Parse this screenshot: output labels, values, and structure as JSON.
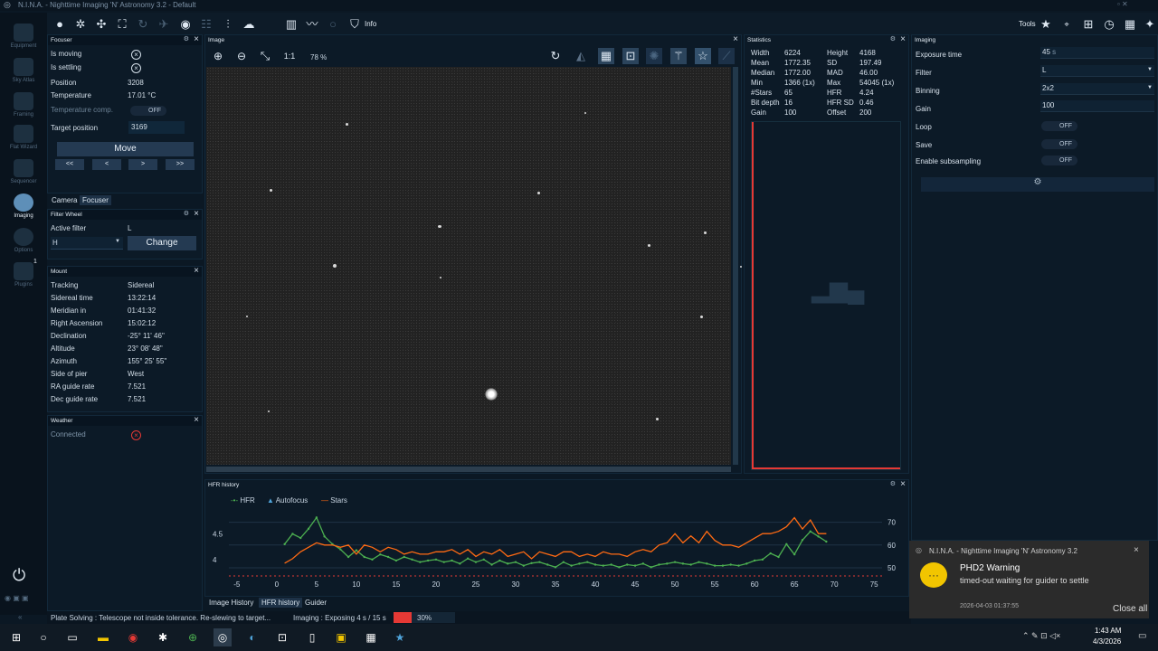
{
  "titlebar": {
    "title": "N.I.N.A. - Nighttime Imaging 'N' Astronomy 3.2  -  Default"
  },
  "toolbar": {
    "info_label": "Info",
    "tools_label": "Tools"
  },
  "sidebar": {
    "items": [
      {
        "label": "Equipment"
      },
      {
        "label": "Sky Atlas"
      },
      {
        "label": "Framing"
      },
      {
        "label": "Flat Wizard"
      },
      {
        "label": "Sequencer"
      },
      {
        "label": "Imaging"
      },
      {
        "label": "Options"
      },
      {
        "label": "Plugins"
      }
    ],
    "plugins_badge": "1"
  },
  "focuser": {
    "title": "Focuser",
    "rows": [
      {
        "label": "Is moving",
        "value": ""
      },
      {
        "label": "Is settling",
        "value": ""
      },
      {
        "label": "Position",
        "value": "3208"
      },
      {
        "label": "Temperature",
        "value": "17.01 °C"
      }
    ],
    "temp_comp_label": "Temperature comp.",
    "temp_comp_value": "OFF",
    "target_label": "Target position",
    "target_value": "3169",
    "move_label": "Move",
    "step_buttons": [
      "<<",
      "<",
      ">",
      ">>"
    ]
  },
  "tabs_left": {
    "camera": "Camera",
    "focuser": "Focuser"
  },
  "filter_wheel": {
    "title": "Filter Wheel",
    "active_label": "Active filter",
    "active_value": "L",
    "select_value": "H",
    "change_label": "Change"
  },
  "mount": {
    "title": "Mount",
    "rows": [
      {
        "label": "Tracking",
        "value": "Sidereal"
      },
      {
        "label": "Sidereal time",
        "value": "13:22:14"
      },
      {
        "label": "Meridian in",
        "value": "01:41:32"
      },
      {
        "label": "Right Ascension",
        "value": "15:02:12"
      },
      {
        "label": "Declination",
        "value": "-25° 11' 46\""
      },
      {
        "label": "Altitude",
        "value": "23° 08' 48\""
      },
      {
        "label": "Azimuth",
        "value": "155° 25' 55\""
      },
      {
        "label": "Side of pier",
        "value": "West"
      },
      {
        "label": "RA guide rate",
        "value": "7.521"
      },
      {
        "label": "Dec guide rate",
        "value": "7.521"
      }
    ]
  },
  "weather": {
    "title": "Weather",
    "connected_label": "Connected"
  },
  "image": {
    "title": "Image",
    "one_to_one": "1:1",
    "zoom": "78 %"
  },
  "statistics": {
    "title": "Statistics",
    "left": [
      {
        "label": "Width",
        "value": "6224"
      },
      {
        "label": "Mean",
        "value": "1772.35"
      },
      {
        "label": "Median",
        "value": "1772.00"
      },
      {
        "label": "Min",
        "value": "1366 (1x)"
      },
      {
        "label": "#Stars",
        "value": "65"
      },
      {
        "label": "Bit depth",
        "value": "16"
      },
      {
        "label": "Gain",
        "value": "100"
      }
    ],
    "right": [
      {
        "label": "Height",
        "value": "4168"
      },
      {
        "label": "SD",
        "value": "197.49"
      },
      {
        "label": "MAD",
        "value": "46.00"
      },
      {
        "label": "Max",
        "value": "54045 (1x)"
      },
      {
        "label": "HFR",
        "value": "4.24"
      },
      {
        "label": "HFR SD",
        "value": "0.46"
      },
      {
        "label": "Offset",
        "value": "200"
      }
    ]
  },
  "imaging": {
    "title": "Imaging",
    "fields": [
      {
        "label": "Exposure time",
        "value": "45",
        "unit": "s"
      },
      {
        "label": "Filter",
        "value": "L"
      },
      {
        "label": "Binning",
        "value": "2x2"
      },
      {
        "label": "Gain",
        "value": "100"
      }
    ],
    "toggles": [
      {
        "label": "Loop",
        "value": "OFF"
      },
      {
        "label": "Save",
        "value": "OFF"
      },
      {
        "label": "Enable subsampling",
        "value": "OFF"
      }
    ]
  },
  "hfr_history": {
    "title": "HFR history",
    "legend": [
      "HFR",
      "Autofocus",
      "Stars"
    ]
  },
  "chart_data": {
    "type": "line",
    "title": "",
    "x_ticks": [
      "-5",
      "0",
      "5",
      "10",
      "15",
      "20",
      "25",
      "30",
      "35",
      "40",
      "45",
      "50",
      "55",
      "60",
      "65",
      "70",
      "75"
    ],
    "y_left_ticks": [
      "4.5",
      "4"
    ],
    "y_right_ticks": [
      "70",
      "60",
      "50"
    ],
    "xlim": [
      -6,
      76
    ],
    "ylim_left": [
      3.75,
      4.95
    ],
    "ylim_right": [
      48,
      75
    ],
    "colors": {
      "hfr": "#4caf50",
      "stars": "#ff6a13"
    },
    "series": [
      {
        "name": "HFR",
        "axis": "left",
        "x": [
          1,
          2,
          3,
          4,
          5,
          6,
          7,
          8,
          9,
          10,
          11,
          12,
          13,
          14,
          15,
          16,
          17,
          18,
          19,
          20,
          21,
          22,
          23,
          24,
          25,
          26,
          27,
          28,
          29,
          30,
          31,
          32,
          33,
          34,
          35,
          36,
          37,
          38,
          39,
          40,
          41,
          42,
          43,
          44,
          45,
          46,
          47,
          48,
          49,
          50,
          51,
          52,
          53,
          54,
          55,
          56,
          57,
          58,
          59,
          60,
          61,
          62,
          63,
          64,
          65,
          66,
          67,
          68,
          69
        ],
        "values": [
          4.3,
          4.5,
          4.42,
          4.6,
          4.82,
          4.45,
          4.3,
          4.2,
          4.05,
          4.18,
          4.05,
          4.0,
          4.1,
          4.05,
          3.98,
          4.05,
          4.0,
          3.95,
          3.98,
          4.0,
          3.95,
          3.98,
          3.92,
          4.02,
          3.95,
          4.0,
          3.9,
          3.98,
          3.92,
          3.95,
          3.88,
          3.93,
          3.95,
          3.9,
          3.85,
          3.95,
          3.88,
          3.92,
          3.95,
          3.9,
          3.88,
          3.9,
          3.85,
          3.9,
          3.88,
          3.92,
          3.85,
          3.9,
          3.92,
          3.95,
          3.92,
          3.9,
          3.95,
          3.92,
          3.88,
          3.88,
          3.9,
          3.88,
          3.92,
          3.98,
          4.0,
          4.12,
          4.05,
          4.3,
          4.1,
          4.38,
          4.55,
          4.45,
          4.35
        ]
      },
      {
        "name": "Stars",
        "axis": "right",
        "x": [
          1,
          2,
          3,
          4,
          5,
          6,
          7,
          8,
          9,
          10,
          11,
          12,
          13,
          14,
          15,
          16,
          17,
          18,
          19,
          20,
          21,
          22,
          23,
          24,
          25,
          26,
          27,
          28,
          29,
          30,
          31,
          32,
          33,
          34,
          35,
          36,
          37,
          38,
          39,
          40,
          41,
          42,
          43,
          44,
          45,
          46,
          47,
          48,
          49,
          50,
          51,
          52,
          53,
          54,
          55,
          56,
          57,
          58,
          59,
          60,
          61,
          62,
          63,
          64,
          65,
          66,
          67,
          68,
          69
        ],
        "values": [
          52,
          54,
          57,
          59,
          61,
          60,
          60,
          59,
          60,
          56,
          60,
          59,
          57,
          59,
          58,
          56,
          57,
          56,
          56,
          57,
          57,
          58,
          56,
          58,
          55,
          57,
          56,
          58,
          55,
          56,
          57,
          54,
          57,
          56,
          55,
          57,
          57,
          55,
          56,
          55,
          57,
          56,
          56,
          55,
          57,
          58,
          57,
          60,
          61,
          65,
          61,
          64,
          61,
          66,
          62,
          60,
          60,
          59,
          61,
          63,
          65,
          65,
          66,
          68,
          72,
          67,
          71,
          65,
          65
        ]
      }
    ]
  },
  "bottom_tabs": [
    "Image History",
    "HFR history",
    "Guider"
  ],
  "statusbar": {
    "plate": "Plate Solving :  Telescope not inside tolerance. Re-slewing to target...",
    "imaging": "Imaging :  Exposing 4 s / 15 s",
    "percent": "30%",
    "progress": 0.3
  },
  "toast": {
    "app": "N.I.N.A. - Nighttime Imaging 'N' Astronomy 3.2",
    "title": "PHD2 Warning",
    "message": "timed-out waiting for guider to settle",
    "time": "2026-04-03 01:37:55",
    "close_all": "Close all"
  },
  "taskbar": {
    "time": "1:43 AM",
    "date": "4/3/2026"
  }
}
